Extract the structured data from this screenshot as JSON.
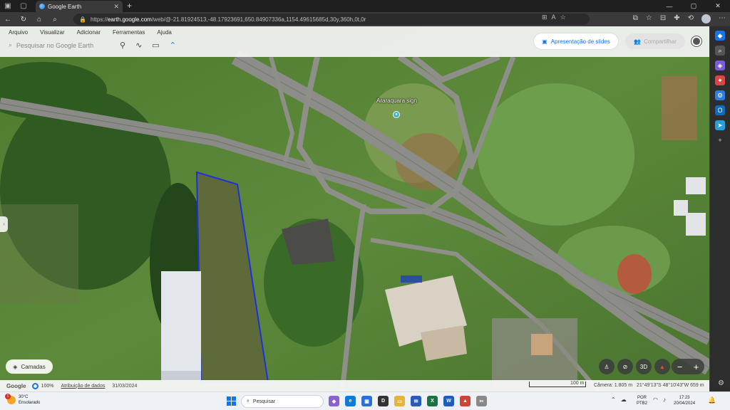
{
  "browser": {
    "tab_title": "Google Earth",
    "url_host": "earth.google.com",
    "url_path": "/web/@-21.81924513,-48.17923691,650.84907336a,1154.49615685d,30y,360h,0t,0r",
    "url_prefix": "https://"
  },
  "earth": {
    "menus": [
      "Arquivo",
      "Visualizar",
      "Adicionar",
      "Ferramentas",
      "Ajuda"
    ],
    "search_placeholder": "Pesquisar no Google Earth",
    "slides_label": "Apresentação de slides",
    "share_label": "Compartilhar",
    "place_label": "Araraquara sign",
    "layers_label": "Camadas",
    "view_3d_label": "3D"
  },
  "status": {
    "google": "Google",
    "percent": "100%",
    "attribution": "Atribuição de dados",
    "date": "31/03/2024",
    "scale": "100 m",
    "camera": "Câmera: 1.805 m",
    "coords": "21°49'13\"S 48°10'43\"W  659 m"
  },
  "taskbar": {
    "temp": "30°C",
    "weather": "Ensolarado",
    "weather_badge": "1",
    "search": "Pesquisar",
    "lang1": "POR",
    "lang2": "PTB2",
    "time": "17:23",
    "date": "20/04/2024"
  },
  "colors": {
    "accent": "#1a73e8",
    "pin": "#3bb7c6",
    "outline": "#1f2fe0"
  }
}
